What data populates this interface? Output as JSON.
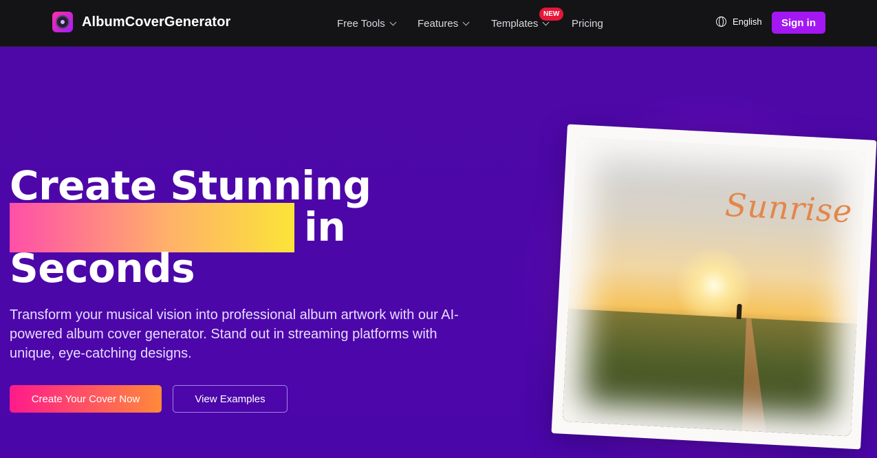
{
  "nav": {
    "brand": "AlbumCoverGenerator",
    "items": [
      {
        "label": "Free Tools",
        "has_dropdown": true
      },
      {
        "label": "Features",
        "has_dropdown": true
      },
      {
        "label": "Templates",
        "has_dropdown": true,
        "badge": "NEW"
      },
      {
        "label": "Pricing",
        "has_dropdown": false
      }
    ],
    "language": "English",
    "sign_in": "Sign in"
  },
  "hero": {
    "headline_line1": "Create Stunning",
    "headline_line2_suffix": "in",
    "headline_line3": "Seconds",
    "subtitle": "Transform your musical vision into professional album artwork with our AI-powered album cover generator. Stand out in streaming platforms with unique, eye-catching designs.",
    "primary_cta": "Create Your Cover Now",
    "secondary_cta": "View Examples"
  },
  "album": {
    "title": "Sunrise"
  },
  "colors": {
    "accent": "#a318f2",
    "hero_bg": "#4b06aa",
    "nav_bg": "#141416",
    "badge": "#e6173a"
  }
}
